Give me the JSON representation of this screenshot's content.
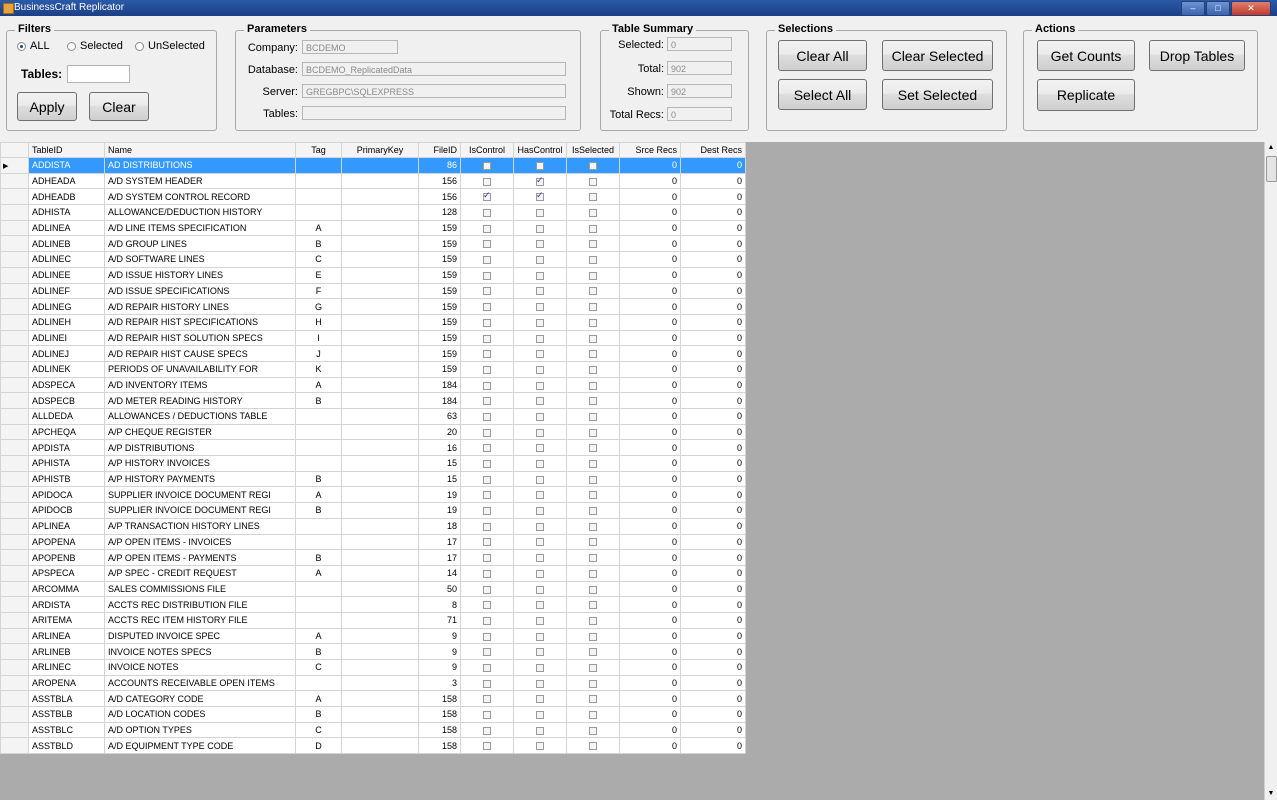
{
  "window": {
    "title": "BusinessCraft Replicator",
    "minimize": "–",
    "maximize": "□",
    "close": "✕"
  },
  "filters": {
    "legend": "Filters",
    "radio_all": "ALL",
    "radio_selected": "Selected",
    "radio_unselected": "UnSelected",
    "selected_option": "ALL",
    "tables_label": "Tables:",
    "tables_value": "",
    "apply_label": "Apply",
    "clear_label": "Clear"
  },
  "parameters": {
    "legend": "Parameters",
    "company_label": "Company:",
    "company_value": "BCDEMO",
    "database_label": "Database:",
    "database_value": "BCDEMO_ReplicatedData",
    "server_label": "Server:",
    "server_value": "GREGBPC\\SQLEXPRESS",
    "tables_label": "Tables:",
    "tables_value": ""
  },
  "summary": {
    "legend": "Table Summary",
    "selected_label": "Selected:",
    "selected_value": "0",
    "total_label": "Total:",
    "total_value": "902",
    "shown_label": "Shown:",
    "shown_value": "902",
    "total_recs_label": "Total Recs:",
    "total_recs_value": "0"
  },
  "selections": {
    "legend": "Selections",
    "clear_all": "Clear All",
    "clear_selected": "Clear Selected",
    "select_all": "Select All",
    "set_selected": "Set Selected"
  },
  "actions": {
    "legend": "Actions",
    "get_counts": "Get Counts",
    "drop_tables": "Drop Tables",
    "replicate": "Replicate"
  },
  "grid": {
    "columns": [
      "TableID",
      "Name",
      "Tag",
      "PrimaryKey",
      "FileID",
      "IsControl",
      "HasControl",
      "IsSelected",
      "Srce Recs",
      "Dest Recs"
    ],
    "selected_row": 0,
    "rows": [
      {
        "id": "ADDISTA",
        "name": "AD DISTRIBUTIONS",
        "tag": "",
        "pk": "",
        "file": "86",
        "isc": false,
        "hasc": false,
        "sel": false,
        "src": "0",
        "dst": "0"
      },
      {
        "id": "ADHEADA",
        "name": "A/D SYSTEM HEADER",
        "tag": "",
        "pk": "",
        "file": "156",
        "isc": false,
        "hasc": true,
        "sel": false,
        "src": "0",
        "dst": "0"
      },
      {
        "id": "ADHEADB",
        "name": "A/D SYSTEM CONTROL RECORD",
        "tag": "",
        "pk": "",
        "file": "156",
        "isc": true,
        "hasc": true,
        "sel": false,
        "src": "0",
        "dst": "0"
      },
      {
        "id": "ADHISTA",
        "name": "ALLOWANCE/DEDUCTION HISTORY",
        "tag": "",
        "pk": "",
        "file": "128",
        "isc": false,
        "hasc": false,
        "sel": false,
        "src": "0",
        "dst": "0"
      },
      {
        "id": "ADLINEA",
        "name": "A/D LINE ITEMS SPECIFICATION",
        "tag": "A",
        "pk": "",
        "file": "159",
        "isc": false,
        "hasc": false,
        "sel": false,
        "src": "0",
        "dst": "0"
      },
      {
        "id": "ADLINEB",
        "name": "A/D GROUP LINES",
        "tag": "B",
        "pk": "",
        "file": "159",
        "isc": false,
        "hasc": false,
        "sel": false,
        "src": "0",
        "dst": "0"
      },
      {
        "id": "ADLINEC",
        "name": "A/D SOFTWARE LINES",
        "tag": "C",
        "pk": "",
        "file": "159",
        "isc": false,
        "hasc": false,
        "sel": false,
        "src": "0",
        "dst": "0"
      },
      {
        "id": "ADLINEE",
        "name": "A/D ISSUE HISTORY LINES",
        "tag": "E",
        "pk": "",
        "file": "159",
        "isc": false,
        "hasc": false,
        "sel": false,
        "src": "0",
        "dst": "0"
      },
      {
        "id": "ADLINEF",
        "name": "A/D ISSUE SPECIFICATIONS",
        "tag": "F",
        "pk": "",
        "file": "159",
        "isc": false,
        "hasc": false,
        "sel": false,
        "src": "0",
        "dst": "0"
      },
      {
        "id": "ADLINEG",
        "name": "A/D REPAIR HISTORY LINES",
        "tag": "G",
        "pk": "",
        "file": "159",
        "isc": false,
        "hasc": false,
        "sel": false,
        "src": "0",
        "dst": "0"
      },
      {
        "id": "ADLINEH",
        "name": "A/D REPAIR HIST SPECIFICATIONS",
        "tag": "H",
        "pk": "",
        "file": "159",
        "isc": false,
        "hasc": false,
        "sel": false,
        "src": "0",
        "dst": "0"
      },
      {
        "id": "ADLINEI",
        "name": "A/D REPAIR HIST SOLUTION SPECS",
        "tag": "I",
        "pk": "",
        "file": "159",
        "isc": false,
        "hasc": false,
        "sel": false,
        "src": "0",
        "dst": "0"
      },
      {
        "id": "ADLINEJ",
        "name": "A/D REPAIR HIST CAUSE SPECS",
        "tag": "J",
        "pk": "",
        "file": "159",
        "isc": false,
        "hasc": false,
        "sel": false,
        "src": "0",
        "dst": "0"
      },
      {
        "id": "ADLINEK",
        "name": "PERIODS OF UNAVAILABILITY FOR",
        "tag": "K",
        "pk": "",
        "file": "159",
        "isc": false,
        "hasc": false,
        "sel": false,
        "src": "0",
        "dst": "0"
      },
      {
        "id": "ADSPECA",
        "name": "A/D INVENTORY ITEMS",
        "tag": "A",
        "pk": "",
        "file": "184",
        "isc": false,
        "hasc": false,
        "sel": false,
        "src": "0",
        "dst": "0"
      },
      {
        "id": "ADSPECB",
        "name": "A/D METER READING HISTORY",
        "tag": "B",
        "pk": "",
        "file": "184",
        "isc": false,
        "hasc": false,
        "sel": false,
        "src": "0",
        "dst": "0"
      },
      {
        "id": "ALLDEDA",
        "name": "ALLOWANCES / DEDUCTIONS TABLE",
        "tag": "",
        "pk": "",
        "file": "63",
        "isc": false,
        "hasc": false,
        "sel": false,
        "src": "0",
        "dst": "0"
      },
      {
        "id": "APCHEQA",
        "name": "A/P CHEQUE REGISTER",
        "tag": "",
        "pk": "",
        "file": "20",
        "isc": false,
        "hasc": false,
        "sel": false,
        "src": "0",
        "dst": "0"
      },
      {
        "id": "APDISTA",
        "name": "A/P DISTRIBUTIONS",
        "tag": "",
        "pk": "",
        "file": "16",
        "isc": false,
        "hasc": false,
        "sel": false,
        "src": "0",
        "dst": "0"
      },
      {
        "id": "APHISTA",
        "name": "A/P HISTORY INVOICES",
        "tag": "",
        "pk": "",
        "file": "15",
        "isc": false,
        "hasc": false,
        "sel": false,
        "src": "0",
        "dst": "0"
      },
      {
        "id": "APHISTB",
        "name": "A/P HISTORY PAYMENTS",
        "tag": "B",
        "pk": "",
        "file": "15",
        "isc": false,
        "hasc": false,
        "sel": false,
        "src": "0",
        "dst": "0"
      },
      {
        "id": "APIDOCA",
        "name": "SUPPLIER INVOICE DOCUMENT REGI",
        "tag": "A",
        "pk": "",
        "file": "19",
        "isc": false,
        "hasc": false,
        "sel": false,
        "src": "0",
        "dst": "0"
      },
      {
        "id": "APIDOCB",
        "name": "SUPPLIER INVOICE DOCUMENT REGI",
        "tag": "B",
        "pk": "",
        "file": "19",
        "isc": false,
        "hasc": false,
        "sel": false,
        "src": "0",
        "dst": "0"
      },
      {
        "id": "APLINEA",
        "name": "A/P TRANSACTION HISTORY LINES",
        "tag": "",
        "pk": "",
        "file": "18",
        "isc": false,
        "hasc": false,
        "sel": false,
        "src": "0",
        "dst": "0"
      },
      {
        "id": "APOPENA",
        "name": "A/P OPEN ITEMS - INVOICES",
        "tag": "",
        "pk": "",
        "file": "17",
        "isc": false,
        "hasc": false,
        "sel": false,
        "src": "0",
        "dst": "0"
      },
      {
        "id": "APOPENB",
        "name": "A/P OPEN ITEMS - PAYMENTS",
        "tag": "B",
        "pk": "",
        "file": "17",
        "isc": false,
        "hasc": false,
        "sel": false,
        "src": "0",
        "dst": "0"
      },
      {
        "id": "APSPECA",
        "name": "A/P SPEC - CREDIT REQUEST",
        "tag": "A",
        "pk": "",
        "file": "14",
        "isc": false,
        "hasc": false,
        "sel": false,
        "src": "0",
        "dst": "0"
      },
      {
        "id": "ARCOMMA",
        "name": "SALES COMMISSIONS FILE",
        "tag": "",
        "pk": "",
        "file": "50",
        "isc": false,
        "hasc": false,
        "sel": false,
        "src": "0",
        "dst": "0"
      },
      {
        "id": "ARDISTA",
        "name": "ACCTS REC DISTRIBUTION FILE",
        "tag": "",
        "pk": "",
        "file": "8",
        "isc": false,
        "hasc": false,
        "sel": false,
        "src": "0",
        "dst": "0"
      },
      {
        "id": "ARITEMA",
        "name": "ACCTS REC ITEM HISTORY FILE",
        "tag": "",
        "pk": "",
        "file": "71",
        "isc": false,
        "hasc": false,
        "sel": false,
        "src": "0",
        "dst": "0"
      },
      {
        "id": "ARLINEA",
        "name": "DISPUTED INVOICE SPEC",
        "tag": "A",
        "pk": "",
        "file": "9",
        "isc": false,
        "hasc": false,
        "sel": false,
        "src": "0",
        "dst": "0"
      },
      {
        "id": "ARLINEB",
        "name": "INVOICE NOTES SPECS",
        "tag": "B",
        "pk": "",
        "file": "9",
        "isc": false,
        "hasc": false,
        "sel": false,
        "src": "0",
        "dst": "0"
      },
      {
        "id": "ARLINEC",
        "name": "INVOICE NOTES",
        "tag": "C",
        "pk": "",
        "file": "9",
        "isc": false,
        "hasc": false,
        "sel": false,
        "src": "0",
        "dst": "0"
      },
      {
        "id": "AROPENA",
        "name": "ACCOUNTS RECEIVABLE OPEN ITEMS",
        "tag": "",
        "pk": "",
        "file": "3",
        "isc": false,
        "hasc": false,
        "sel": false,
        "src": "0",
        "dst": "0"
      },
      {
        "id": "ASSTBLA",
        "name": "A/D CATEGORY CODE",
        "tag": "A",
        "pk": "",
        "file": "158",
        "isc": false,
        "hasc": false,
        "sel": false,
        "src": "0",
        "dst": "0"
      },
      {
        "id": "ASSTBLB",
        "name": "A/D LOCATION CODES",
        "tag": "B",
        "pk": "",
        "file": "158",
        "isc": false,
        "hasc": false,
        "sel": false,
        "src": "0",
        "dst": "0"
      },
      {
        "id": "ASSTBLC",
        "name": "A/D OPTION TYPES",
        "tag": "C",
        "pk": "",
        "file": "158",
        "isc": false,
        "hasc": false,
        "sel": false,
        "src": "0",
        "dst": "0"
      },
      {
        "id": "ASSTBLD",
        "name": "A/D EQUIPMENT TYPE CODE",
        "tag": "D",
        "pk": "",
        "file": "158",
        "isc": false,
        "hasc": false,
        "sel": false,
        "src": "0",
        "dst": "0"
      }
    ]
  }
}
